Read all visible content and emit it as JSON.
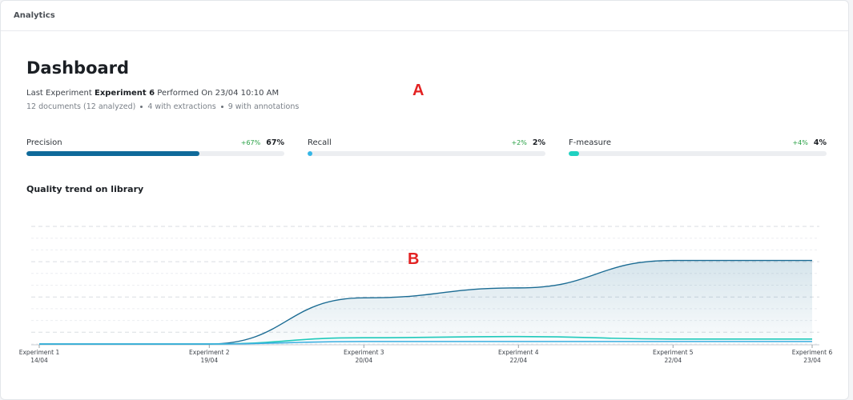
{
  "header": {
    "section": "Analytics"
  },
  "dashboard": {
    "title": "Dashboard",
    "last_prefix": "Last Experiment",
    "experiment_name": "Experiment 6",
    "performed_text": "Performed On 23/04 10:10 AM",
    "stats": [
      "12 documents (12 analyzed)",
      "4 with extractions",
      "9 with annotations"
    ]
  },
  "annotations": {
    "a": "A",
    "b": "B"
  },
  "metrics": [
    {
      "label": "Precision",
      "delta": "+67%",
      "value": "67%",
      "fraction": 0.67,
      "color": "#0f6a9a"
    },
    {
      "label": "Recall",
      "delta": "+2%",
      "value": "2%",
      "fraction": 0.02,
      "color": "#35b6e6"
    },
    {
      "label": "F-measure",
      "delta": "+4%",
      "value": "4%",
      "fraction": 0.04,
      "color": "#1fd1c1"
    }
  ],
  "chart_title": "Quality trend on library",
  "chart_data": {
    "type": "area",
    "categories": [
      {
        "name": "Experiment 1",
        "date": "14/04"
      },
      {
        "name": "Experiment 2",
        "date": "19/04"
      },
      {
        "name": "Experiment 3",
        "date": "20/04"
      },
      {
        "name": "Experiment 4",
        "date": "22/04"
      },
      {
        "name": "Experiment 5",
        "date": "22/04"
      },
      {
        "name": "Experiment 6",
        "date": "23/04"
      }
    ],
    "x_positions": [
      0,
      1.1,
      2.1,
      3.1,
      4.1,
      5
    ],
    "ylim": [
      0,
      100
    ],
    "grid": true,
    "series": [
      {
        "values": [
          0,
          0,
          37,
          45,
          67,
          67
        ],
        "color": "#1a6b93",
        "fill": true
      },
      {
        "values": [
          0,
          0,
          5,
          6,
          4,
          4
        ],
        "color": "#1fc9bb",
        "fill": false
      },
      {
        "values": [
          0,
          0,
          2,
          2,
          2,
          2
        ],
        "color": "#3aaee0",
        "fill": false
      }
    ]
  }
}
